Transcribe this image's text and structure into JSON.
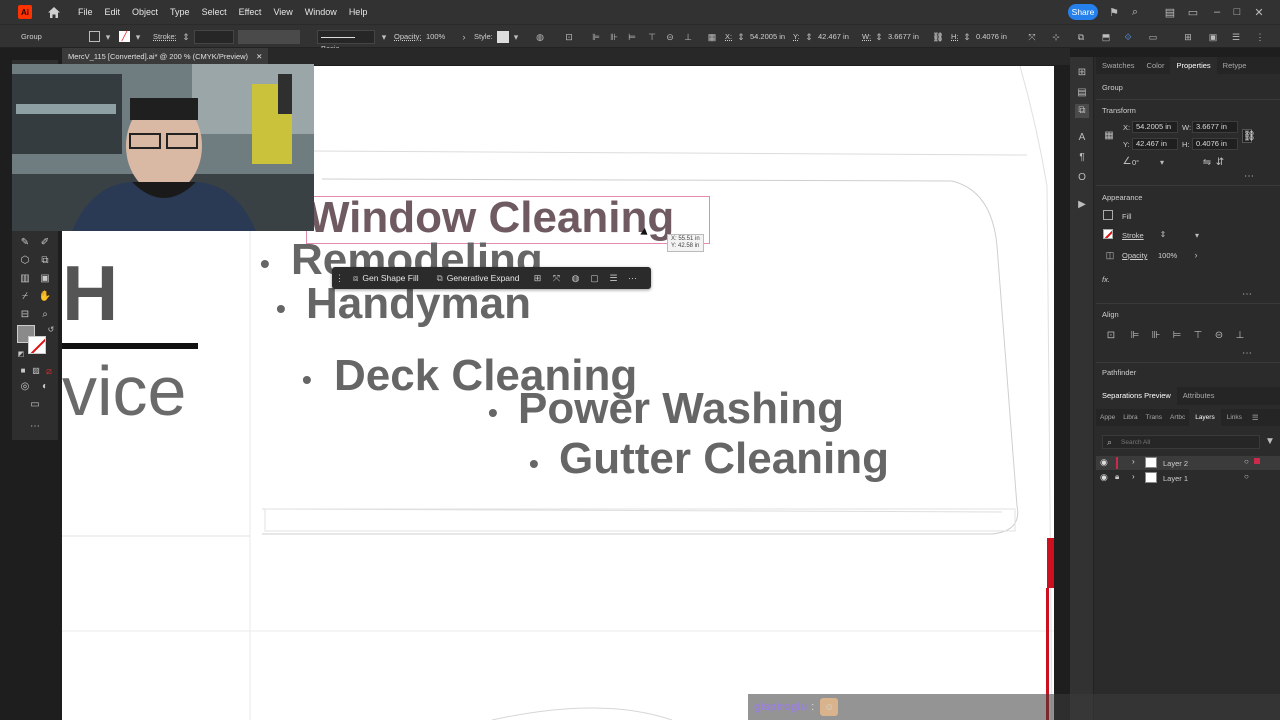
{
  "menubar": {
    "app_logo": "Ai",
    "items": [
      "File",
      "Edit",
      "Object",
      "Type",
      "Select",
      "Effect",
      "View",
      "Window",
      "Help"
    ],
    "share_label": "Share"
  },
  "controlbar": {
    "selection_type": "Group",
    "stroke_label": "Stroke:",
    "brush_label": "Basic",
    "opacity_label": "Opacity:",
    "opacity_value": "100%",
    "style_label": "Style:",
    "x_label": "X:",
    "x_value": "54.2005 in",
    "y_label": "Y:",
    "y_value": "42.467 in",
    "w_label": "W:",
    "w_value": "3.6677 in",
    "h_label": "H:",
    "h_value": "0.4076 in"
  },
  "document": {
    "tab_title": "MercV_115 [Converted].ai* @ 200 % (CMYK/Preview)"
  },
  "canvas": {
    "left_partial_letter": "H",
    "left_partial_word": "vice",
    "services": {
      "window_cleaning": "Window Cleaning",
      "remodeling": "Remodeling",
      "handyman": "Handyman",
      "deck_cleaning": "Deck Cleaning",
      "power_washing": "Power Washing",
      "gutter_cleaning": "Gutter Cleaning"
    },
    "bullet": "•",
    "cursor_tooltip_x": "X: 55.51 in",
    "cursor_tooltip_y": "Y: 42.58 in"
  },
  "taskbar": {
    "gen_shape_fill": "Gen Shape Fill",
    "generative_expand": "Generative Expand"
  },
  "rightpanel": {
    "tabs": [
      "Swatches",
      "Color",
      "Properties",
      "Retype"
    ],
    "active_tab": "Properties",
    "section_group": "Group",
    "transform_title": "Transform",
    "x_label": "X:",
    "x_value": "54.2005 in",
    "y_label": "Y:",
    "y_value": "42.467 in",
    "w_label": "W:",
    "w_value": "3.6677 in",
    "h_label": "H:",
    "h_value": "0.4076 in",
    "angle_value": "0°",
    "appearance_title": "Appearance",
    "fill_label": "Fill",
    "stroke_label": "Stroke",
    "opacity_label": "Opacity",
    "opacity_value": "100%",
    "fx_label": "fx.",
    "align_title": "Align",
    "pathfinder_title": "Pathfinder",
    "lower_tabs": [
      "Separations Preview",
      "Attributes"
    ],
    "layer_tabs": [
      "Appe",
      "Libra",
      "Trans",
      "Artbc",
      "Layers",
      "Links"
    ],
    "active_layer_tab": "Layers",
    "search_placeholder": "Search All",
    "layers": [
      {
        "name": "Layer 2",
        "selected": true,
        "color": "#cc2a4a"
      },
      {
        "name": "Layer 1",
        "selected": false,
        "color": "#4a7acc"
      }
    ]
  },
  "chat": {
    "username": "gispiroglu",
    "separator": ":"
  },
  "colors": {
    "accent": "#2680eb",
    "selection": "#d64f8a",
    "canvas_text": "#666666"
  }
}
